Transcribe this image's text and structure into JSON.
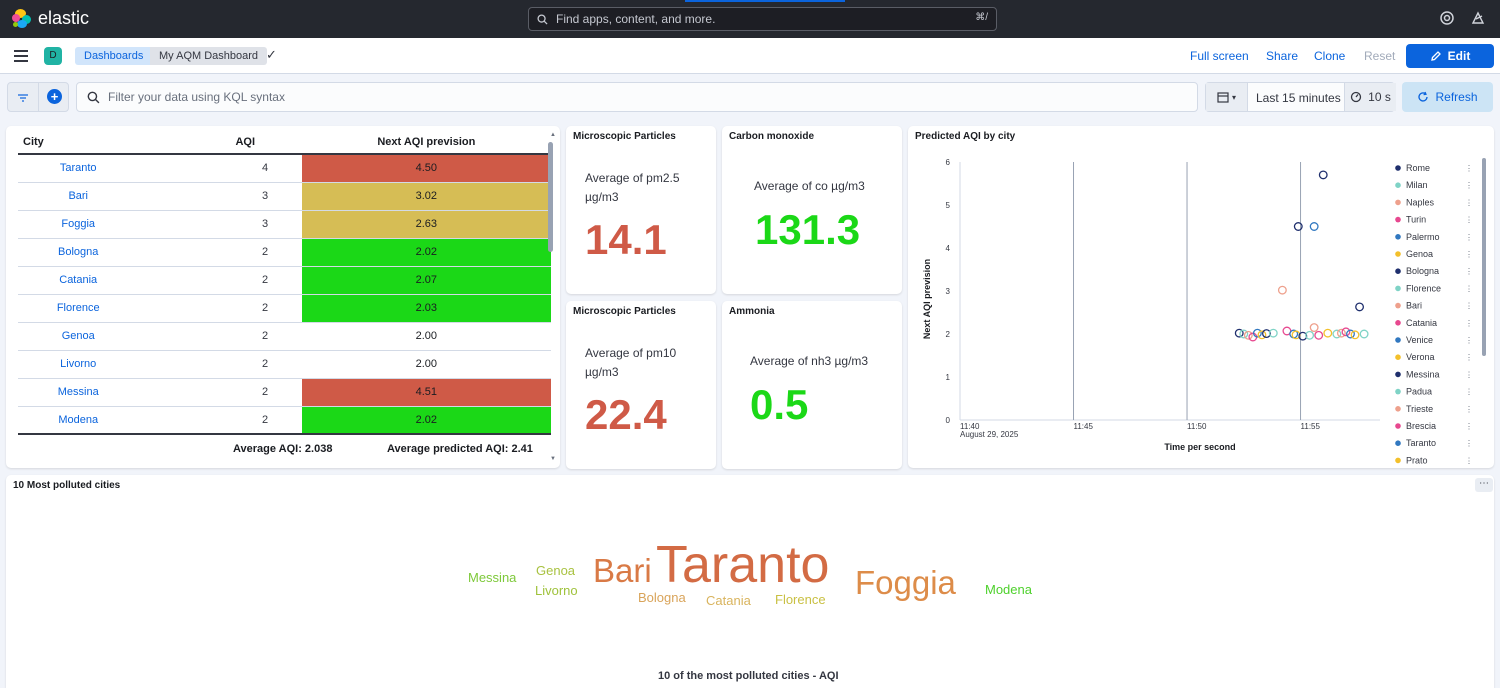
{
  "app": {
    "brand": "elastic"
  },
  "global_search": {
    "placeholder": "Find apps, content, and more.",
    "shortcut": "⌘/"
  },
  "navbar": {
    "space_initial": "D",
    "breadcrumbs": [
      "Dashboards",
      "My AQM Dashboard"
    ],
    "actions": {
      "full_screen": "Full screen",
      "share": "Share",
      "clone": "Clone",
      "reset": "Reset",
      "edit": "Edit"
    }
  },
  "query": {
    "placeholder": "Filter your data using KQL syntax",
    "time_range": "Last 15 minutes",
    "refresh_interval": "10 s",
    "refresh": "Refresh"
  },
  "table_panel": {
    "columns": [
      "City",
      "AQI",
      "Next AQI prevision"
    ],
    "rows": [
      {
        "city": "Taranto",
        "aqi": "4",
        "next": "4.50",
        "color": "#cf5a47"
      },
      {
        "city": "Bari",
        "aqi": "3",
        "next": "3.02",
        "color": "#d6bd55"
      },
      {
        "city": "Foggia",
        "aqi": "3",
        "next": "2.63",
        "color": "#d6bd55"
      },
      {
        "city": "Bologna",
        "aqi": "2",
        "next": "2.02",
        "color": "#1bd817"
      },
      {
        "city": "Catania",
        "aqi": "2",
        "next": "2.07",
        "color": "#1bd817"
      },
      {
        "city": "Florence",
        "aqi": "2",
        "next": "2.03",
        "color": "#1bd817"
      },
      {
        "city": "Genoa",
        "aqi": "2",
        "next": "2.00",
        "color": "#ffffff"
      },
      {
        "city": "Livorno",
        "aqi": "2",
        "next": "2.00",
        "color": "#ffffff"
      },
      {
        "city": "Messina",
        "aqi": "2",
        "next": "4.51",
        "color": "#cf5a47"
      },
      {
        "city": "Modena",
        "aqi": "2",
        "next": "2.02",
        "color": "#1bd817"
      }
    ],
    "footer": {
      "avg_aqi": "Average AQI: 2.038",
      "avg_predicted": "Average predicted AQI: 2.41"
    }
  },
  "metrics": {
    "pm25": {
      "title": "Microscopic Particles",
      "label": "Average of pm2.5 µg/m3",
      "value": "14.1",
      "color": "#cf5a47"
    },
    "co": {
      "title": "Carbon monoxide",
      "label": "Average of co µg/m3",
      "value": "131.3",
      "color": "#1bd817"
    },
    "pm10": {
      "title": "Microscopic Particles",
      "label": "Average of pm10 µg/m3",
      "value": "22.4",
      "color": "#cf5a47"
    },
    "nh3": {
      "title": "Ammonia",
      "label": "Average of nh3 µg/m3",
      "value": "0.5",
      "color": "#1bd817"
    }
  },
  "scatter_panel": {
    "title": "Predicted AQI by city",
    "date_label": "August 29, 2025"
  },
  "chart_data": [
    {
      "type": "scatter",
      "title": "Predicted AQI by city",
      "xlabel": "Time per second",
      "ylabel": "Next AQI prevision",
      "x_ticks": [
        "11:40",
        "11:45",
        "11:50",
        "11:55"
      ],
      "y_ticks": [
        "0",
        "1",
        "2",
        "3",
        "4",
        "5",
        "6"
      ],
      "ylim": [
        0,
        6
      ],
      "xlim_minutes": [
        40,
        57.2
      ],
      "grid": true,
      "legend_position": "right",
      "legend": [
        {
          "name": "Rome",
          "color": "#1f2f6d"
        },
        {
          "name": "Milan",
          "color": "#7fd3c6"
        },
        {
          "name": "Naples",
          "color": "#eea08c"
        },
        {
          "name": "Turin",
          "color": "#e7488f"
        },
        {
          "name": "Palermo",
          "color": "#3178c0"
        },
        {
          "name": "Genoa",
          "color": "#f3c02b"
        },
        {
          "name": "Bologna",
          "color": "#1f2f6d"
        },
        {
          "name": "Florence",
          "color": "#7fd3c6"
        },
        {
          "name": "Bari",
          "color": "#eea08c"
        },
        {
          "name": "Catania",
          "color": "#e7488f"
        },
        {
          "name": "Venice",
          "color": "#3178c0"
        },
        {
          "name": "Verona",
          "color": "#f3c02b"
        },
        {
          "name": "Messina",
          "color": "#1f2f6d"
        },
        {
          "name": "Padua",
          "color": "#7fd3c6"
        },
        {
          "name": "Trieste",
          "color": "#eea08c"
        },
        {
          "name": "Brescia",
          "color": "#e7488f"
        },
        {
          "name": "Taranto",
          "color": "#3178c0"
        },
        {
          "name": "Prato",
          "color": "#f3c02b"
        }
      ],
      "points": [
        {
          "x": 52.3,
          "y": 2.02,
          "color": "#1f2f6d"
        },
        {
          "x": 52.5,
          "y": 2.0,
          "color": "#7fd3c6"
        },
        {
          "x": 52.7,
          "y": 1.97,
          "color": "#eea08c"
        },
        {
          "x": 52.9,
          "y": 1.93,
          "color": "#e7488f"
        },
        {
          "x": 53.1,
          "y": 2.02,
          "color": "#3178c0"
        },
        {
          "x": 53.3,
          "y": 1.98,
          "color": "#f3c02b"
        },
        {
          "x": 53.5,
          "y": 2.01,
          "color": "#1f2f6d"
        },
        {
          "x": 53.8,
          "y": 2.02,
          "color": "#7fd3c6"
        },
        {
          "x": 54.2,
          "y": 3.02,
          "color": "#eea08c"
        },
        {
          "x": 54.4,
          "y": 2.07,
          "color": "#e7488f"
        },
        {
          "x": 54.7,
          "y": 2.0,
          "color": "#3178c0"
        },
        {
          "x": 54.8,
          "y": 1.98,
          "color": "#f3c02b"
        },
        {
          "x": 54.9,
          "y": 4.5,
          "color": "#1f2f6d"
        },
        {
          "x": 55.1,
          "y": 1.95,
          "color": "#1f2f6d"
        },
        {
          "x": 55.4,
          "y": 1.97,
          "color": "#7fd3c6"
        },
        {
          "x": 55.6,
          "y": 2.15,
          "color": "#eea08c"
        },
        {
          "x": 55.8,
          "y": 1.97,
          "color": "#e7488f"
        },
        {
          "x": 55.6,
          "y": 4.5,
          "color": "#3178c0"
        },
        {
          "x": 56.0,
          "y": 5.7,
          "color": "#1f2f6d"
        },
        {
          "x": 56.2,
          "y": 2.02,
          "color": "#f3c02b"
        },
        {
          "x": 56.6,
          "y": 2.0,
          "color": "#7fd3c6"
        },
        {
          "x": 56.8,
          "y": 2.02,
          "color": "#eea08c"
        },
        {
          "x": 57.0,
          "y": 2.05,
          "color": "#e7488f"
        },
        {
          "x": 57.2,
          "y": 2.0,
          "color": "#3178c0"
        },
        {
          "x": 57.4,
          "y": 1.98,
          "color": "#f3c02b"
        },
        {
          "x": 57.6,
          "y": 2.63,
          "color": "#1f2f6d"
        },
        {
          "x": 57.8,
          "y": 2.0,
          "color": "#7fd3c6"
        }
      ]
    },
    {
      "type": "word-cloud",
      "title": "10 of the most polluted cities - AQI",
      "words": [
        {
          "text": "Taranto",
          "weight": 4,
          "color": "#d36b44"
        },
        {
          "text": "Foggia",
          "weight": 3,
          "color": "#dd8c49"
        },
        {
          "text": "Bari",
          "weight": 3,
          "color": "#d97a46"
        },
        {
          "text": "Bologna",
          "weight": 2,
          "color": "#d9a45a"
        },
        {
          "text": "Catania",
          "weight": 2,
          "color": "#d9b45e"
        },
        {
          "text": "Florence",
          "weight": 2,
          "color": "#c9c043"
        },
        {
          "text": "Genoa",
          "weight": 2,
          "color": "#a9c241"
        },
        {
          "text": "Livorno",
          "weight": 2,
          "color": "#9fc23b"
        },
        {
          "text": "Messina",
          "weight": 2,
          "color": "#7ec93a"
        },
        {
          "text": "Modena",
          "weight": 2,
          "color": "#4ed12c"
        }
      ]
    }
  ],
  "wordcloud_panel": {
    "title": "10 Most polluted cities",
    "caption": "10 of the most polluted cities - AQI"
  }
}
